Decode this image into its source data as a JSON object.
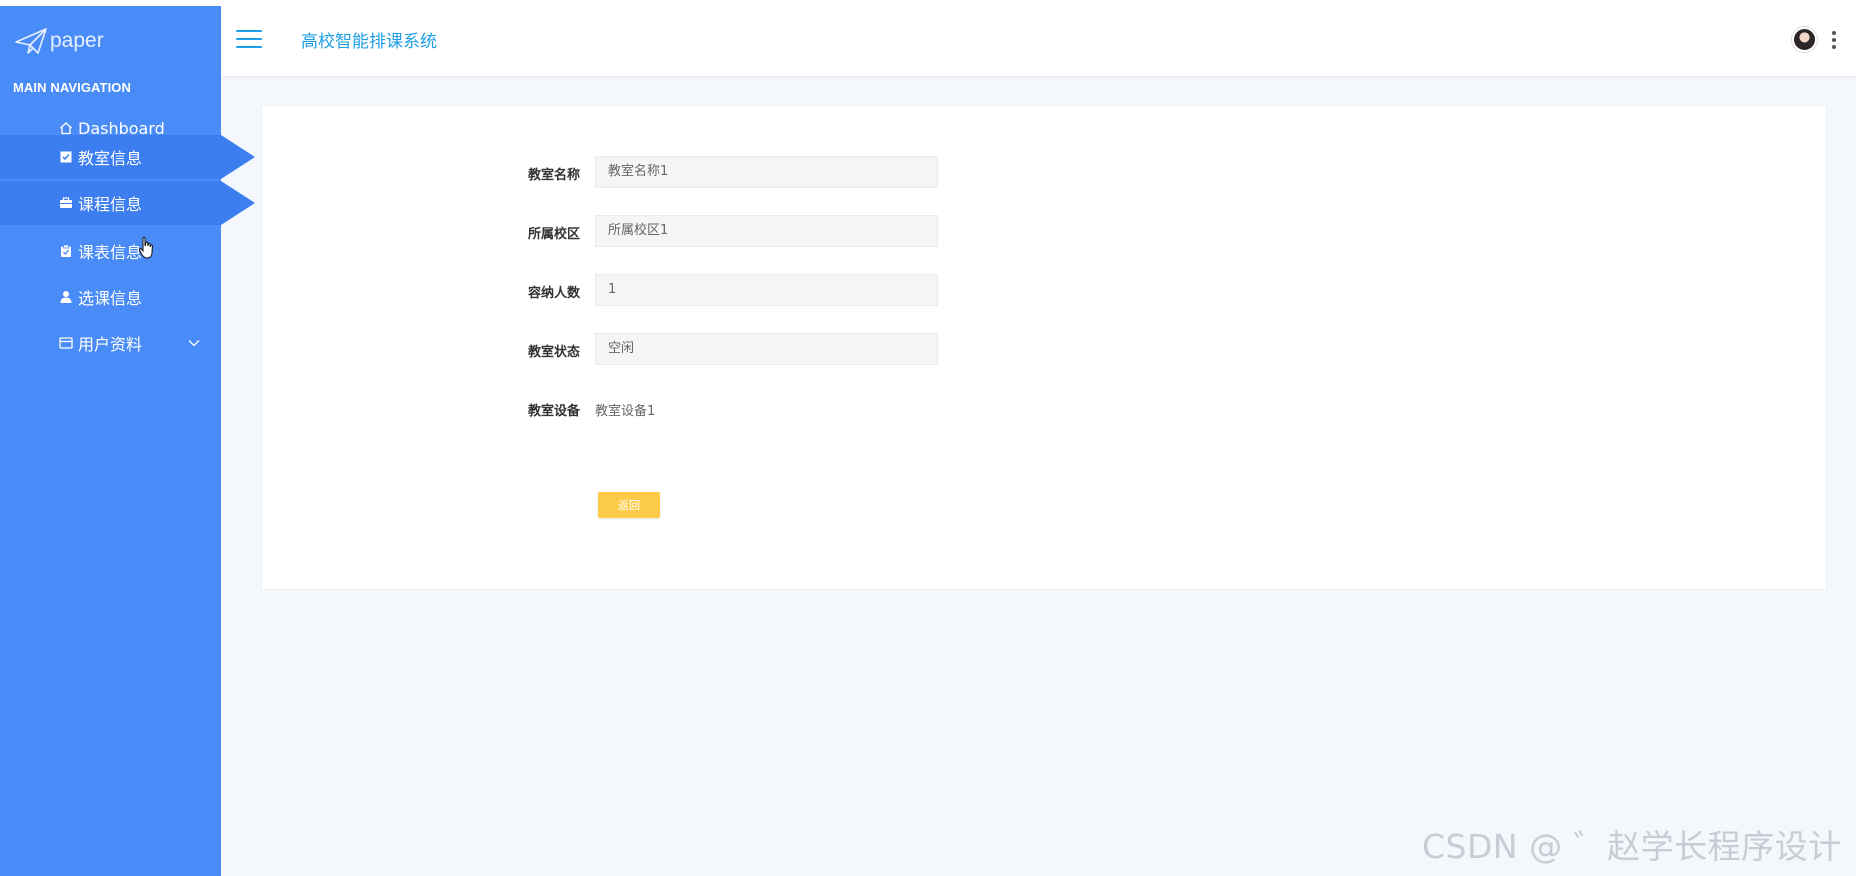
{
  "sidebar": {
    "logo_text": "paper",
    "nav_title": "MAIN NAVIGATION",
    "items": [
      {
        "label": "Dashboard",
        "icon": "home-icon"
      },
      {
        "label": "教室信息",
        "icon": "checkbox-icon"
      },
      {
        "label": "课程信息",
        "icon": "briefcase-icon"
      },
      {
        "label": "课表信息",
        "icon": "clipboard-icon"
      },
      {
        "label": "选课信息",
        "icon": "user-icon"
      },
      {
        "label": "用户资料",
        "icon": "card-icon"
      }
    ]
  },
  "header": {
    "title": "高校智能排课系统"
  },
  "form": {
    "fields": [
      {
        "label": "教室名称",
        "value": "教室名称1"
      },
      {
        "label": "所属校区",
        "value": "所属校区1"
      },
      {
        "label": "容纳人数",
        "value": "1"
      },
      {
        "label": "教室状态",
        "value": "空闲"
      },
      {
        "label": "教室设备",
        "value": "教室设备1"
      }
    ],
    "back_label": "返回"
  },
  "watermark": "CSDN @ ゛赵学长程序设计",
  "colors": {
    "sidebar_bg": "#4a8cf7",
    "sidebar_active": "#3c7ef0",
    "accent": "#1f9fe6",
    "button": "#fccb48"
  }
}
